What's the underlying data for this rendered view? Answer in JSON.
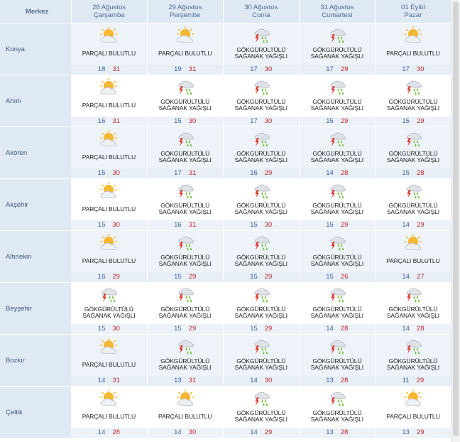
{
  "header": {
    "corner": "Merkez",
    "days": [
      {
        "date": "28 Ağustos",
        "weekday": "Çarşamba"
      },
      {
        "date": "29 Ağustos",
        "weekday": "Perşembe"
      },
      {
        "date": "30 Ağustos",
        "weekday": "Cuma"
      },
      {
        "date": "31 Ağustos",
        "weekday": "Cumartesi"
      },
      {
        "date": "01 Eylül",
        "weekday": "Pazar"
      }
    ]
  },
  "conditions": {
    "pb": {
      "line1": "PARÇALI BULUTLU",
      "line2": "",
      "icon": "partly-cloudy-icon"
    },
    "gs": {
      "line1": "GÖKGÜRÜLTÜLÜ",
      "line2": "SAĞANAK YAĞIŞLI",
      "icon": "thunderstorm-icon"
    }
  },
  "rows": [
    {
      "city": "Konya",
      "days": [
        {
          "c": "pb",
          "min": "18",
          "max": "31"
        },
        {
          "c": "pb",
          "min": "19",
          "max": "31"
        },
        {
          "c": "gs",
          "min": "17",
          "max": "30"
        },
        {
          "c": "gs",
          "min": "17",
          "max": "29"
        },
        {
          "c": "pb",
          "min": "17",
          "max": "30"
        }
      ]
    },
    {
      "city": "Ahırlı",
      "days": [
        {
          "c": "pb",
          "min": "16",
          "max": "31"
        },
        {
          "c": "gs",
          "min": "15",
          "max": "30"
        },
        {
          "c": "gs",
          "min": "17",
          "max": "30"
        },
        {
          "c": "gs",
          "min": "15",
          "max": "29"
        },
        {
          "c": "gs",
          "min": "15",
          "max": "29"
        }
      ]
    },
    {
      "city": "Akören",
      "days": [
        {
          "c": "pb",
          "min": "15",
          "max": "30"
        },
        {
          "c": "gs",
          "min": "17",
          "max": "31"
        },
        {
          "c": "gs",
          "min": "16",
          "max": "29"
        },
        {
          "c": "gs",
          "min": "14",
          "max": "28"
        },
        {
          "c": "gs",
          "min": "15",
          "max": "28"
        }
      ]
    },
    {
      "city": "Akşehir",
      "days": [
        {
          "c": "pb",
          "min": "15",
          "max": "30"
        },
        {
          "c": "gs",
          "min": "16",
          "max": "31"
        },
        {
          "c": "gs",
          "min": "15",
          "max": "30"
        },
        {
          "c": "gs",
          "min": "15",
          "max": "29"
        },
        {
          "c": "gs",
          "min": "14",
          "max": "29"
        }
      ]
    },
    {
      "city": "Altınekin",
      "days": [
        {
          "c": "pb",
          "min": "16",
          "max": "29"
        },
        {
          "c": "gs",
          "min": "15",
          "max": "29"
        },
        {
          "c": "gs",
          "min": "15",
          "max": "29"
        },
        {
          "c": "gs",
          "min": "15",
          "max": "26"
        },
        {
          "c": "pb",
          "min": "14",
          "max": "27"
        }
      ]
    },
    {
      "city": "Beyşehir",
      "days": [
        {
          "c": "gs",
          "min": "15",
          "max": "30"
        },
        {
          "c": "gs",
          "min": "15",
          "max": "29"
        },
        {
          "c": "gs",
          "min": "15",
          "max": "29"
        },
        {
          "c": "gs",
          "min": "14",
          "max": "28"
        },
        {
          "c": "gs",
          "min": "14",
          "max": "28"
        }
      ]
    },
    {
      "city": "Bozkır",
      "days": [
        {
          "c": "pb",
          "min": "14",
          "max": "31"
        },
        {
          "c": "gs",
          "min": "13",
          "max": "31"
        },
        {
          "c": "gs",
          "min": "14",
          "max": "30"
        },
        {
          "c": "gs",
          "min": "13",
          "max": "28"
        },
        {
          "c": "gs",
          "min": "11",
          "max": "29"
        }
      ]
    },
    {
      "city": "Çeltik",
      "days": [
        {
          "c": "pb",
          "min": "14",
          "max": "28"
        },
        {
          "c": "pb",
          "min": "14",
          "max": "30"
        },
        {
          "c": "gs",
          "min": "14",
          "max": "29"
        },
        {
          "c": "gs",
          "min": "13",
          "max": "28"
        },
        {
          "c": "pb",
          "min": "13",
          "max": "29"
        }
      ]
    }
  ],
  "colors": {
    "min": "#3b62a8",
    "max": "#c0282a",
    "header_bg": "#dfe9f4"
  }
}
